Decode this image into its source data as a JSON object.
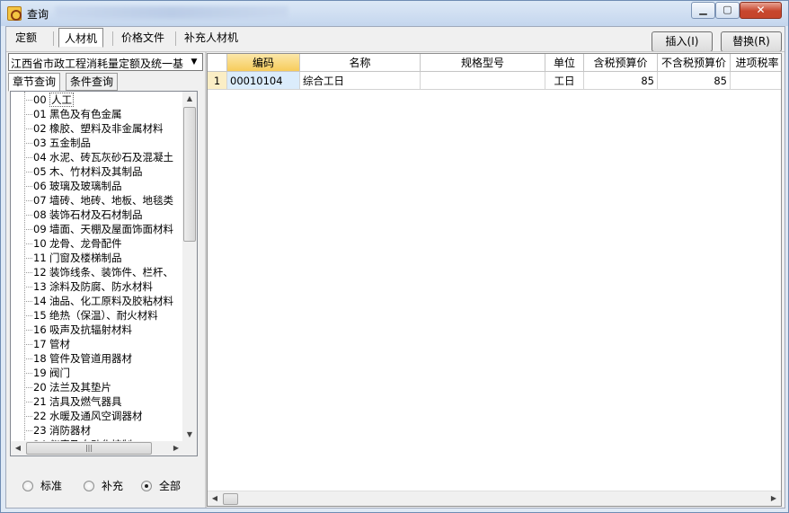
{
  "window": {
    "title": "查询",
    "min_glyph": "▁",
    "max_glyph": "▢",
    "close_glyph": "✕"
  },
  "top_tabs": [
    "定额",
    "人材机",
    "价格文件",
    "补充人材机"
  ],
  "buttons": {
    "insert": "插入(I)",
    "replace": "替换(R)"
  },
  "left": {
    "combo_value": "江西省市政工程消耗量定额及统一基",
    "subtabs": [
      "章节查询",
      "条件查询"
    ],
    "tree": [
      {
        "code": "00",
        "name": "人工"
      },
      {
        "code": "01",
        "name": "黑色及有色金属"
      },
      {
        "code": "02",
        "name": "橡胶、塑料及非金属材料"
      },
      {
        "code": "03",
        "name": "五金制品"
      },
      {
        "code": "04",
        "name": "水泥、砖瓦灰砂石及混凝土"
      },
      {
        "code": "05",
        "name": "木、竹材料及其制品"
      },
      {
        "code": "06",
        "name": "玻璃及玻璃制品"
      },
      {
        "code": "07",
        "name": "墙砖、地砖、地板、地毯类"
      },
      {
        "code": "08",
        "name": "装饰石材及石材制品"
      },
      {
        "code": "09",
        "name": "墙面、天棚及屋面饰面材料"
      },
      {
        "code": "10",
        "name": "龙骨、龙骨配件"
      },
      {
        "code": "11",
        "name": "门窗及楼梯制品"
      },
      {
        "code": "12",
        "name": "装饰线条、装饰件、栏杆、"
      },
      {
        "code": "13",
        "name": "涂料及防腐、防水材料"
      },
      {
        "code": "14",
        "name": "油品、化工原料及胶粘材料"
      },
      {
        "code": "15",
        "name": "绝热（保温）、耐火材料"
      },
      {
        "code": "16",
        "name": "吸声及抗辐射材料"
      },
      {
        "code": "17",
        "name": "管材"
      },
      {
        "code": "18",
        "name": "管件及管道用器材"
      },
      {
        "code": "19",
        "name": "阀门"
      },
      {
        "code": "20",
        "name": "法兰及其垫片"
      },
      {
        "code": "21",
        "name": "洁具及燃气器具"
      },
      {
        "code": "22",
        "name": "水暖及通风空调器材"
      },
      {
        "code": "23",
        "name": "消防器材"
      },
      {
        "code": "24",
        "name": "仪表及自动化控制"
      }
    ],
    "radios": [
      {
        "label": "标准",
        "checked": false
      },
      {
        "label": "补充",
        "checked": false
      },
      {
        "label": "全部",
        "checked": true
      }
    ]
  },
  "grid": {
    "columns": [
      "编码",
      "名称",
      "规格型号",
      "单位",
      "含税预算价",
      "不含税预算价",
      "进项税率"
    ],
    "rows": [
      {
        "no": "1",
        "code": "00010104",
        "name": "综合工日",
        "spec": "",
        "unit": "工日",
        "price_tax": "85",
        "price_notax": "85",
        "rate": ""
      }
    ]
  }
}
